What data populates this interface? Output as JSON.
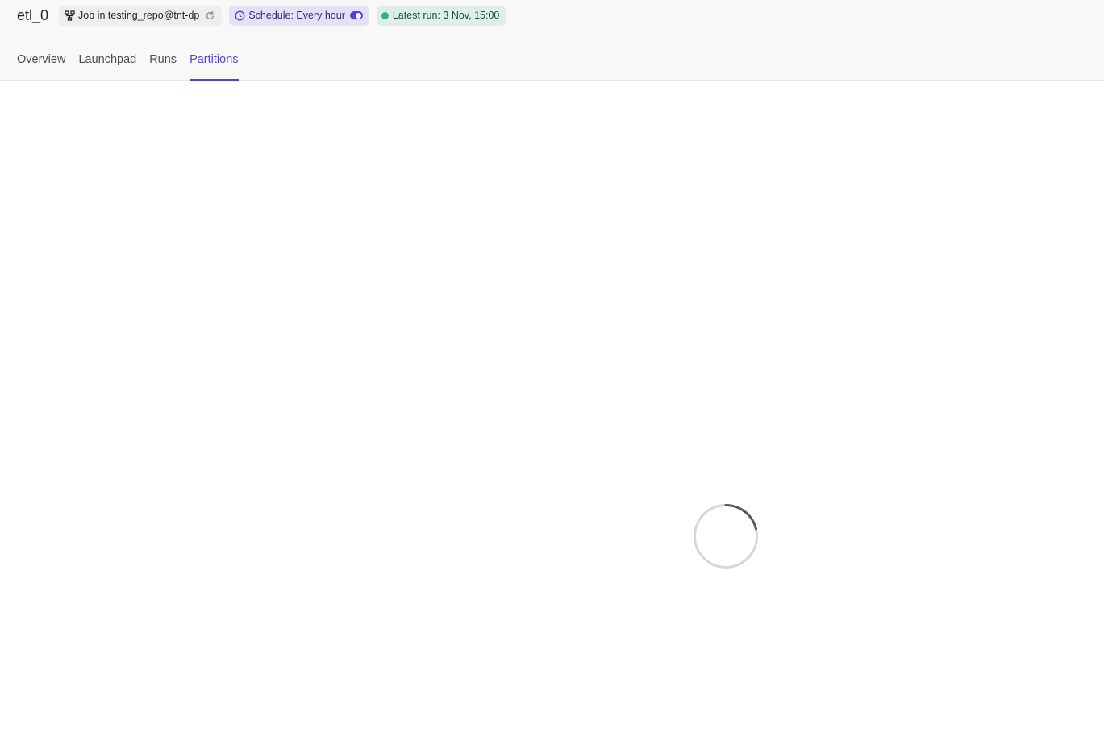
{
  "header": {
    "title": "etl_0",
    "job_tag": {
      "prefix": "Job in",
      "repo": "testing_repo@tnt-dp",
      "icon": "job-graph-icon",
      "reload_icon": "reload-icon"
    },
    "schedule_tag": {
      "label": "Schedule: Every hour",
      "icon": "clock-icon",
      "toggle_on": true
    },
    "run_tag": {
      "label": "Latest run: 3 Nov, 15:00",
      "status_color": "#2fb673"
    }
  },
  "tabs": [
    {
      "label": "Overview",
      "active": false
    },
    {
      "label": "Launchpad",
      "active": false
    },
    {
      "label": "Runs",
      "active": false
    },
    {
      "label": "Partitions",
      "active": true
    }
  ],
  "colors": {
    "accent": "#4f43dd",
    "success": "#2fb673"
  },
  "main": {
    "loading": true
  }
}
